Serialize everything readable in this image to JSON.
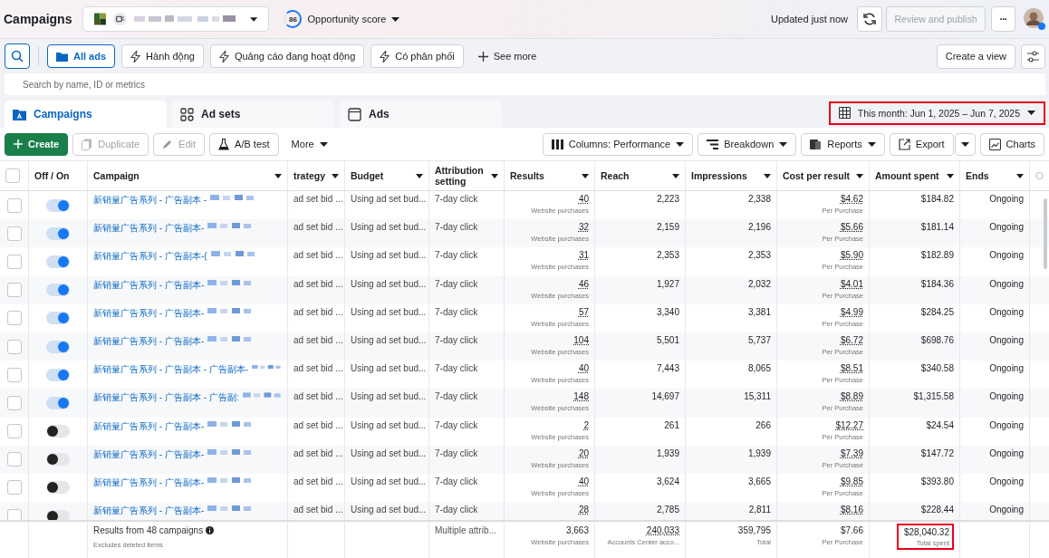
{
  "header": {
    "title": "Campaigns",
    "opportunity": {
      "score": "86",
      "label": "Opportunity score"
    },
    "updated": "Updated just now",
    "publish": {
      "label": "Review and publish",
      "disabled": true
    },
    "more": "···"
  },
  "filters": [
    {
      "label": "All ads",
      "selected": true
    },
    {
      "label": "Hành động",
      "selected": false
    },
    {
      "label": "Quảng cáo đang hoạt động",
      "selected": false
    },
    {
      "label": "Có phân phối",
      "selected": false
    }
  ],
  "see_more": "See more",
  "create_view": "Create a view",
  "search": {
    "placeholder": "Search by name, ID or metrics"
  },
  "tabs": [
    {
      "label": "Campaigns",
      "selected": true
    },
    {
      "label": "Ad sets",
      "selected": false
    },
    {
      "label": "Ads",
      "selected": false
    }
  ],
  "date_range": "This month: Jun 1, 2025 – Jun 7, 2025",
  "toolbar_left": [
    {
      "label": "Create",
      "disabled": false
    },
    {
      "label": "Duplicate",
      "disabled": true
    },
    {
      "label": "Edit",
      "disabled": true
    },
    {
      "label": "A/B test",
      "disabled": false
    },
    {
      "label": "More",
      "disabled": false
    }
  ],
  "toolbar_right": [
    {
      "label": "Columns: Performance"
    },
    {
      "label": "Breakdown"
    },
    {
      "label": "Reports"
    },
    {
      "label": "Export"
    },
    {
      "label": "Charts"
    }
  ],
  "table": {
    "select_all": {
      "checked": false
    },
    "columns": [
      "Off / On",
      "Campaign",
      "trategy",
      "Budget",
      "Attribution setting",
      "Results",
      "Reach",
      "Impressions",
      "Cost per result",
      "Amount spent",
      "Ends"
    ],
    "rows": [
      {
        "selected": false,
        "on": true,
        "campaign": "新销量广告系列 - 广告副本 -",
        "strategy": "ad set bid ...",
        "budget": "Using ad set bud...",
        "attribution": "7-day click",
        "results": "40",
        "results_note": "Website purchases",
        "reach": "2,223",
        "impressions": "2,338",
        "cost": "$4.62",
        "cost_note": "Per Purchase",
        "spent": "$184.82",
        "ends": "Ongoing"
      },
      {
        "selected": false,
        "on": true,
        "campaign": "新销量广告系列 - 广告副本-",
        "strategy": "ad set bid ...",
        "budget": "Using ad set bud...",
        "attribution": "7-day click",
        "results": "32",
        "results_note": "Website purchases",
        "reach": "2,159",
        "impressions": "2,196",
        "cost": "$5.66",
        "cost_note": "Per Purchase",
        "spent": "$181.14",
        "ends": "Ongoing"
      },
      {
        "selected": false,
        "on": true,
        "campaign": "新销量广告系列 - 广告副本-(",
        "strategy": "ad set bid ...",
        "budget": "Using ad set bud...",
        "attribution": "7-day click",
        "results": "31",
        "results_note": "Website purchases",
        "reach": "2,353",
        "impressions": "2,353",
        "cost": "$5.90",
        "cost_note": "Per Purchase",
        "spent": "$182.89",
        "ends": "Ongoing"
      },
      {
        "selected": false,
        "on": true,
        "campaign": "新销量广告系列 - 广告副本-",
        "strategy": "ad set bid ...",
        "budget": "Using ad set bud...",
        "attribution": "7-day click",
        "results": "46",
        "results_note": "Website purchases",
        "reach": "1,927",
        "impressions": "2,032",
        "cost": "$4.01",
        "cost_note": "Per Purchase",
        "spent": "$184.36",
        "ends": "Ongoing"
      },
      {
        "selected": false,
        "on": true,
        "campaign": "新销量广告系列 - 广告副本-",
        "strategy": "ad set bid ...",
        "budget": "Using ad set bud...",
        "attribution": "7-day click",
        "results": "57",
        "results_note": "Website purchases",
        "reach": "3,340",
        "impressions": "3,381",
        "cost": "$4.99",
        "cost_note": "Per Purchase",
        "spent": "$284.25",
        "ends": "Ongoing"
      },
      {
        "selected": false,
        "on": true,
        "campaign": "新销量广告系列 - 广告副本-",
        "strategy": "ad set bid ...",
        "budget": "Using ad set bud...",
        "attribution": "7-day click",
        "results": "104",
        "results_note": "Website purchases",
        "reach": "5,501",
        "impressions": "5,737",
        "cost": "$6.72",
        "cost_note": "Per Purchase",
        "spent": "$698.76",
        "ends": "Ongoing"
      },
      {
        "selected": false,
        "on": true,
        "campaign": "新销量广告系列 - 广告副本 - 广告副本-",
        "strategy": "ad set bid ...",
        "budget": "Using ad set bud...",
        "attribution": "7-day click",
        "results": "40",
        "results_note": "Website purchases",
        "reach": "7,443",
        "impressions": "8,065",
        "cost": "$8.51",
        "cost_note": "Per Purchase",
        "spent": "$340.58",
        "ends": "Ongoing"
      },
      {
        "selected": false,
        "on": true,
        "campaign": "新销量广告系列 - 广告副本 - 广告副:",
        "strategy": "ad set bid ...",
        "budget": "Using ad set bud...",
        "attribution": "7-day click",
        "results": "148",
        "results_note": "Website purchases",
        "reach": "14,697",
        "impressions": "15,311",
        "cost": "$8.89",
        "cost_note": "Per Purchase",
        "spent": "$1,315.58",
        "ends": "Ongoing"
      },
      {
        "selected": false,
        "on": false,
        "campaign": "新销量广告系列 - 广告副本-",
        "strategy": "ad set bid ...",
        "budget": "Using ad set bud...",
        "attribution": "7-day click",
        "results": "2",
        "results_note": "Website purchases",
        "reach": "261",
        "impressions": "266",
        "cost": "$12.27",
        "cost_note": "Per Purchase",
        "spent": "$24.54",
        "ends": "Ongoing"
      },
      {
        "selected": false,
        "on": false,
        "campaign": "新销量广告系列 - 广告副本-",
        "strategy": "ad set bid ...",
        "budget": "Using ad set bud...",
        "attribution": "7-day click",
        "results": "20",
        "results_note": "Website purchases",
        "reach": "1,939",
        "impressions": "1,939",
        "cost": "$7.39",
        "cost_note": "Per Purchase",
        "spent": "$147.72",
        "ends": "Ongoing"
      },
      {
        "selected": false,
        "on": false,
        "campaign": "新销量广告系列 - 广告副本-",
        "strategy": "ad set bid ...",
        "budget": "Using ad set bud...",
        "attribution": "7-day click",
        "results": "40",
        "results_note": "Website purchases",
        "reach": "3,624",
        "impressions": "3,665",
        "cost": "$9.85",
        "cost_note": "Per Purchase",
        "spent": "$393.80",
        "ends": "Ongoing"
      },
      {
        "selected": false,
        "on": false,
        "campaign": "新销量广告系列 - 广告副本-",
        "strategy": "ad set bid ...",
        "budget": "Using ad set bud...",
        "attribution": "7-day click",
        "results": "28",
        "reach": "2,785",
        "impressions": "2,811",
        "cost": "$8.16",
        "spent": "$228.44",
        "ends": "Ongoing"
      }
    ],
    "footer": {
      "summary": "Results from 48 campaigns",
      "summary_note": "Excludes deleted items",
      "attribution": "Multiple attrib...",
      "results": "3,663",
      "results_note": "Website purchases",
      "reach": "240,033",
      "reach_note": "Accounts Center acco...",
      "impressions": "359,795",
      "impressions_note": "Total",
      "cost": "$7.66",
      "cost_note": "Per Purchase",
      "spent": "$28,040.32",
      "spent_note": "Total spent"
    }
  }
}
